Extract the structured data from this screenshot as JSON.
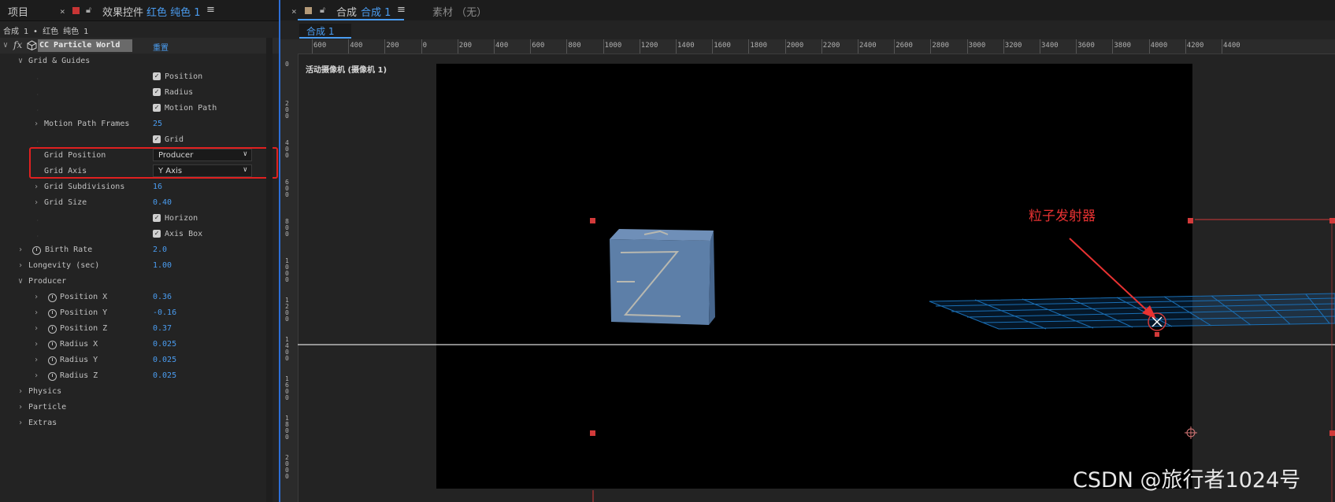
{
  "left_panel": {
    "tab_project": "项目",
    "tab_close": "×",
    "tab_effect_controls": "效果控件",
    "tab_effect_target": "红色 纯色 1",
    "tab_menu": "≡",
    "layer_path": "合成 1 • 红色 纯色 1",
    "effect": {
      "fx": "fx",
      "name": "CC Particle World",
      "reset": "重置"
    },
    "rows": {
      "grid_guides": "Grid & Guides",
      "position": "Position",
      "radius": "Radius",
      "motion_path": "Motion Path",
      "motion_path_frames": "Motion Path Frames",
      "motion_path_frames_value": "25",
      "grid": "Grid",
      "grid_position": "Grid Position",
      "grid_position_value": "Producer",
      "grid_axis": "Grid Axis",
      "grid_axis_value": "Y Axis",
      "grid_subdivisions": "Grid Subdivisions",
      "grid_subdivisions_value": "16",
      "grid_size": "Grid Size",
      "grid_size_value": "0.40",
      "horizon": "Horizon",
      "axis_box": "Axis Box",
      "birth_rate": "Birth Rate",
      "birth_rate_value": "2.0",
      "longevity": "Longevity (sec)",
      "longevity_value": "1.00",
      "producer": "Producer",
      "position_x": "Position X",
      "position_x_value": "0.36",
      "position_y": "Position Y",
      "position_y_value": "-0.16",
      "position_z": "Position Z",
      "position_z_value": "0.37",
      "radius_x": "Radius X",
      "radius_x_value": "0.025",
      "radius_y": "Radius Y",
      "radius_y_value": "0.025",
      "radius_z": "Radius Z",
      "radius_z_value": "0.025",
      "physics": "Physics",
      "particle": "Particle",
      "extras": "Extras"
    }
  },
  "right_panel": {
    "tab_close": "×",
    "tab_comp": "合成",
    "tab_comp_name": "合成 1",
    "tab_menu": "≡",
    "tab_footage": "素材 （无）",
    "comp_subtab": "合成 1",
    "ruler_labels": [
      "600",
      "400",
      "200",
      "0",
      "200",
      "400",
      "600",
      "800",
      "1000",
      "1200",
      "1400",
      "1600",
      "1800",
      "2000",
      "2200",
      "2400",
      "2600",
      "2800",
      "3000",
      "3200",
      "3400",
      "3600",
      "3800",
      "4000",
      "4200",
      "4400"
    ],
    "vruler_labels": [
      "0",
      "200",
      "400",
      "600",
      "800",
      "1000",
      "1200",
      "1400",
      "1600",
      "1800",
      "2000"
    ],
    "camera_label": "活动摄像机 (摄像机 1)",
    "annotation": "粒子发射器",
    "watermark": "CSDN @旅行者1024号"
  },
  "colors": {
    "accent_blue": "#4a9cf0",
    "highlight_red": "#e83232",
    "grid_blue": "#1a6fb5",
    "cube_blue": "#5d7fa8"
  }
}
